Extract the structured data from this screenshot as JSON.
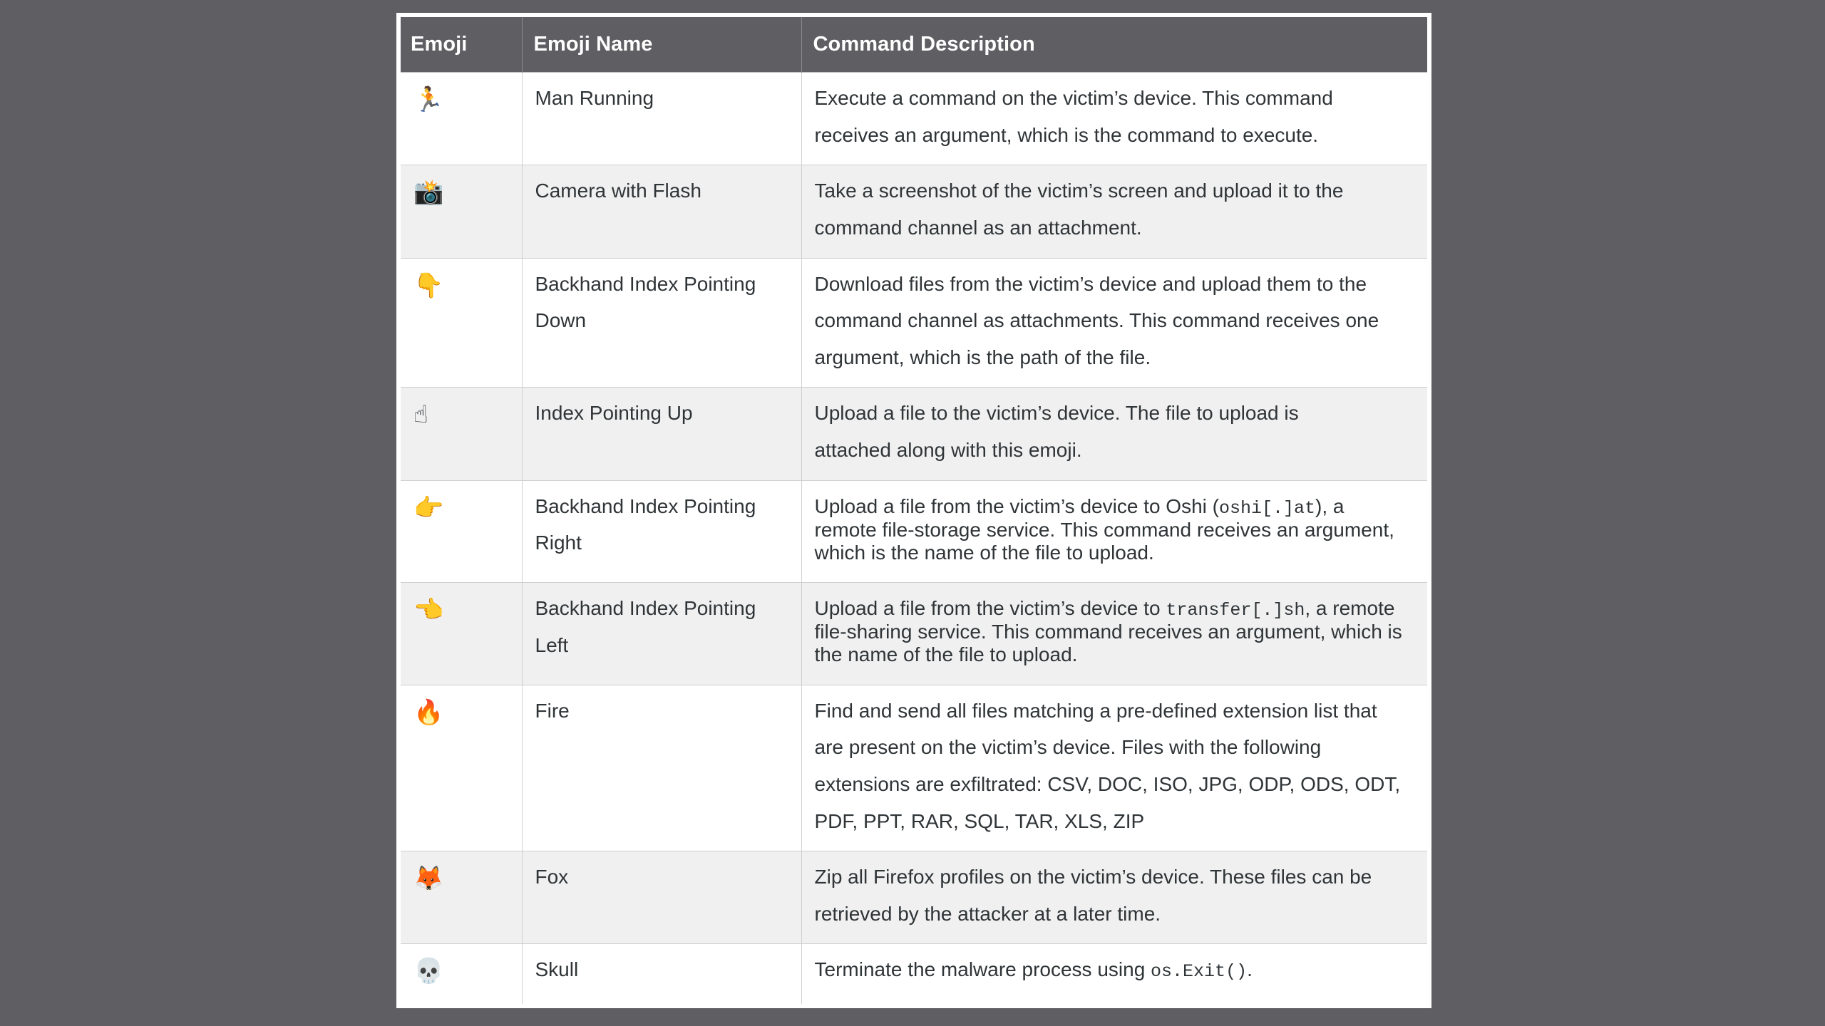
{
  "page": {
    "background_color": "#5e5e63",
    "frame_color": "#ffffff"
  },
  "table": {
    "header_background": "#5e5e63",
    "header_text_color": "#ffffff",
    "row_alt_background": "#f0f0f0",
    "row_background": "#ffffff",
    "border_color": "#cfcfd2",
    "columns": [
      {
        "key": "emoji",
        "label": "Emoji"
      },
      {
        "key": "emoji_name",
        "label": "Emoji Name"
      },
      {
        "key": "command_description",
        "label": "Command Description"
      }
    ],
    "rows": [
      {
        "emoji": "🏃",
        "emoji_icon_name": "man-running-emoji",
        "emoji_name": "Man Running",
        "description_lines": [
          "Execute a command on the victim’s device. This command",
          "receives an argument, which is the command to execute."
        ],
        "description_plain": "Execute a command on the victim’s device. This command receives an argument, which is the command to execute."
      },
      {
        "emoji": "📸",
        "emoji_icon_name": "camera-with-flash-emoji",
        "emoji_name": "Camera with Flash",
        "description_lines": [
          "Take a screenshot of the victim’s screen and upload it to the",
          "command channel as an attachment."
        ],
        "description_plain": "Take a screenshot of the victim’s screen and upload it to the command channel as an attachment."
      },
      {
        "emoji": "👇",
        "emoji_icon_name": "backhand-index-pointing-down-emoji",
        "emoji_name": "Backhand Index Pointing Down",
        "name_lines": [
          "Backhand Index Pointing",
          "Down"
        ],
        "description_lines": [
          "Download files from the victim’s device and upload them to the",
          "command channel as attachments. This command receives one",
          "argument, which is the path of the file."
        ],
        "description_plain": "Download files from the victim’s device and upload them to the command channel as attachments. This command receives one argument, which is the path of the file."
      },
      {
        "emoji": "☝",
        "emoji_icon_name": "index-pointing-up-emoji",
        "emoji_name": "Index Pointing Up",
        "description_lines": [
          "Upload a file to the victim’s device. The file to upload is",
          "attached along with this emoji."
        ],
        "description_plain": "Upload a file to the victim’s device. The file to upload is attached along with this emoji."
      },
      {
        "emoji": "👉",
        "emoji_icon_name": "backhand-index-pointing-right-emoji",
        "emoji_name": "Backhand Index Pointing Right",
        "name_lines": [
          "Backhand Index Pointing",
          "Right"
        ],
        "description_segments": [
          {
            "text": "Upload a file from the victim’s device to Oshi (",
            "mono": false
          },
          {
            "text": "oshi[.]at",
            "mono": true
          },
          {
            "text": "), a remote file-storage service. This command receives an argument, which is the name of the file to upload.",
            "mono": false
          }
        ],
        "description_plain": "Upload a file from the victim’s device to Oshi (oshi[.]at), a remote file-storage service. This command receives an argument, which is the name of the file to upload."
      },
      {
        "emoji": "👈",
        "emoji_icon_name": "backhand-index-pointing-left-emoji",
        "emoji_name": "Backhand Index Pointing Left",
        "name_lines": [
          "Backhand Index Pointing",
          "Left"
        ],
        "description_segments": [
          {
            "text": "Upload a file from the victim’s device to ",
            "mono": false
          },
          {
            "text": "transfer[.]sh",
            "mono": true
          },
          {
            "text": ", a remote file-sharing service. This command receives an argument, which is the name of the file to upload.",
            "mono": false
          }
        ],
        "description_plain": "Upload a file from the victim’s device to transfer[.]sh, a remote file-sharing service. This command receives an argument, which is the name of the file to upload."
      },
      {
        "emoji": "🔥",
        "emoji_icon_name": "fire-emoji",
        "emoji_name": "Fire",
        "description_lines": [
          "Find and send all files matching a pre-defined extension list that",
          "are present on the victim’s device. Files with the following",
          "extensions are exfiltrated: CSV, DOC, ISO, JPG, ODP, ODS, ODT,",
          "PDF, PPT, RAR, SQL, TAR, XLS, ZIP"
        ],
        "description_plain": "Find and send all files matching a pre-defined extension list that are present on the victim’s device. Files with the following extensions are exfiltrated: CSV, DOC, ISO, JPG, ODP, ODS, ODT, PDF, PPT, RAR, SQL, TAR, XLS, ZIP",
        "exfiltrated_extensions": [
          "CSV",
          "DOC",
          "ISO",
          "JPG",
          "ODP",
          "ODS",
          "ODT",
          "PDF",
          "PPT",
          "RAR",
          "SQL",
          "TAR",
          "XLS",
          "ZIP"
        ]
      },
      {
        "emoji": "🦊",
        "emoji_icon_name": "fox-emoji",
        "emoji_name": "Fox",
        "description_lines": [
          "Zip all Firefox profiles on the victim’s device. These files can be",
          "retrieved by the attacker at a later time."
        ],
        "description_plain": "Zip all Firefox profiles on the victim’s device. These files can be retrieved by the attacker at a later time."
      },
      {
        "emoji": "💀",
        "emoji_icon_name": "skull-emoji",
        "emoji_name": "Skull",
        "description_segments": [
          {
            "text": "Terminate the malware process using ",
            "mono": false
          },
          {
            "text": "os.Exit()",
            "mono": true
          },
          {
            "text": ".",
            "mono": false
          }
        ],
        "description_plain": "Terminate the malware process using os.Exit()."
      }
    ]
  }
}
